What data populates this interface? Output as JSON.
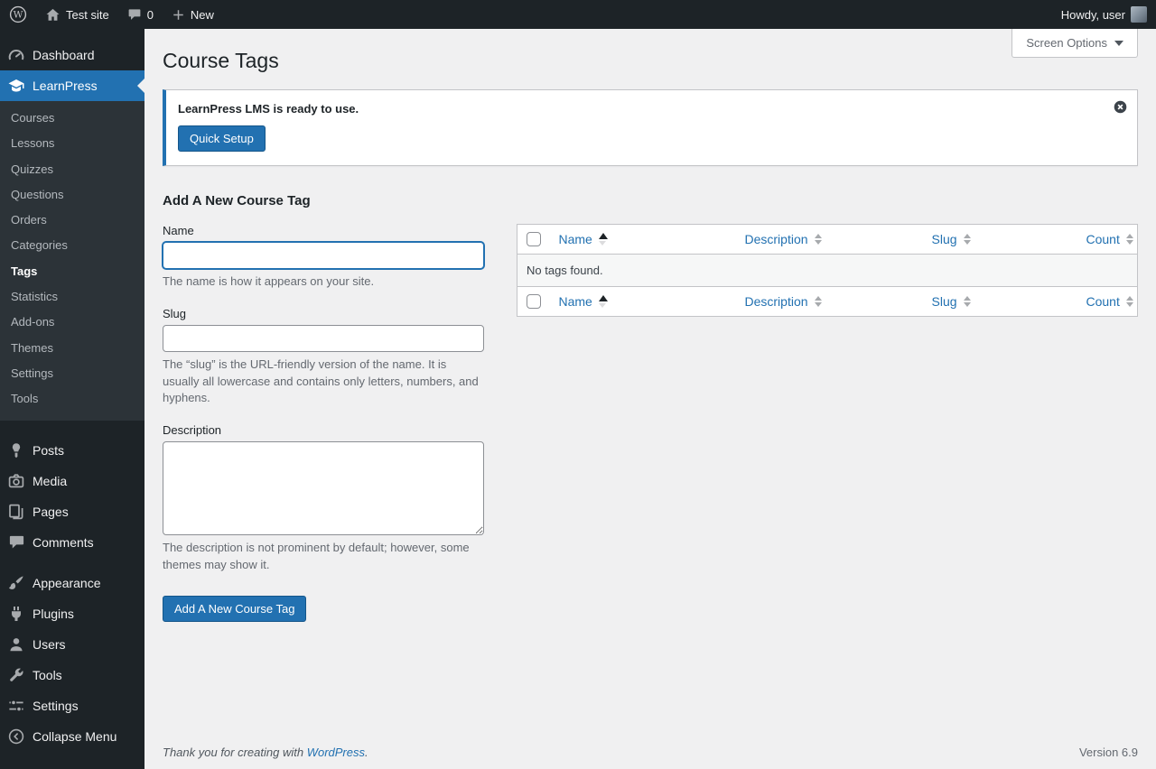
{
  "admin_bar": {
    "site_name": "Test site",
    "comments_count": "0",
    "new_label": "New",
    "howdy_text": "Howdy, user"
  },
  "sidebar": {
    "dashboard": "Dashboard",
    "learnpress": "LearnPress",
    "learnpress_submenu": [
      "Courses",
      "Lessons",
      "Quizzes",
      "Questions",
      "Orders",
      "Categories",
      "Tags",
      "Statistics",
      "Add-ons",
      "Themes",
      "Settings",
      "Tools"
    ],
    "posts": "Posts",
    "media": "Media",
    "pages": "Pages",
    "comments": "Comments",
    "appearance": "Appearance",
    "plugins": "Plugins",
    "users": "Users",
    "tools": "Tools",
    "settings": "Settings",
    "collapse": "Collapse Menu"
  },
  "header": {
    "page_title": "Course Tags",
    "screen_options": "Screen Options"
  },
  "notice": {
    "message": "LearnPress LMS is ready to use.",
    "quick_setup": "Quick Setup"
  },
  "form": {
    "heading": "Add A New Course Tag",
    "name_label": "Name",
    "name_help": "The name is how it appears on your site.",
    "slug_label": "Slug",
    "slug_help": "The “slug” is the URL-friendly version of the name. It is usually all lowercase and contains only letters, numbers, and hyphens.",
    "description_label": "Description",
    "description_help": "The description is not prominent by default; however, some themes may show it.",
    "submit": "Add A New Course Tag"
  },
  "table": {
    "columns": [
      "Name",
      "Description",
      "Slug",
      "Count"
    ],
    "empty_message": "No tags found."
  },
  "footer": {
    "thanks_prefix": "Thank you for creating with ",
    "wordpress_link": "WordPress",
    "thanks_suffix": ".",
    "version": "Version 6.9"
  },
  "colors": {
    "accent": "#2271b1",
    "admin_bar_bg": "#1d2327",
    "content_bg": "#f0f0f1"
  }
}
